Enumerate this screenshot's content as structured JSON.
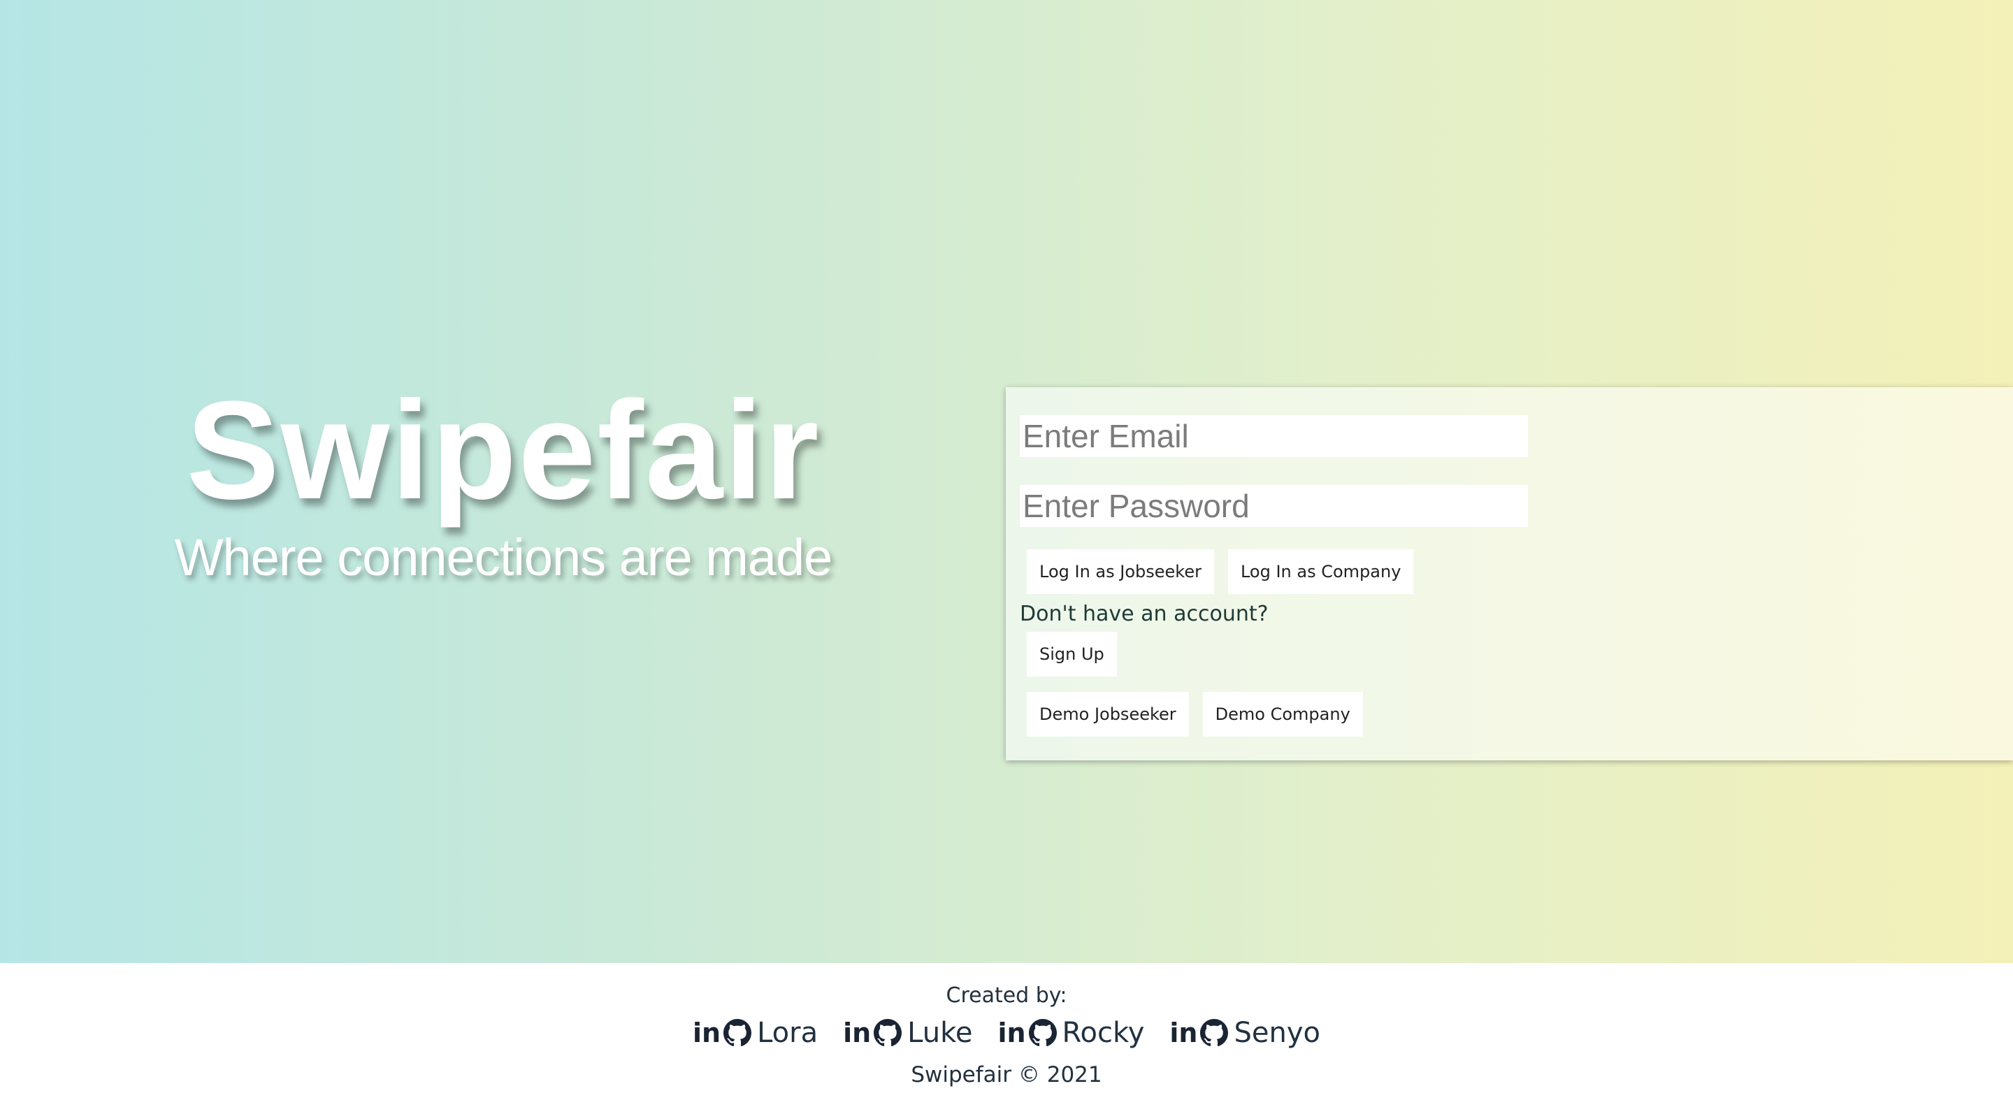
{
  "brand": {
    "title": "Swipefair",
    "tagline": "Where connections are made"
  },
  "login": {
    "email_placeholder": "Enter Email",
    "password_placeholder": "Enter Password",
    "login_jobseeker_label": "Log In as Jobseeker",
    "login_company_label": "Log In as Company",
    "no_account_text": "Don't have an account?",
    "signup_label": "Sign Up",
    "demo_jobseeker_label": "Demo Jobseeker",
    "demo_company_label": "Demo Company"
  },
  "footer": {
    "created_by": "Created by:",
    "authors": [
      {
        "name": "Lora",
        "icons": [
          "linkedin-icon",
          "github-icon"
        ]
      },
      {
        "name": "Luke",
        "icons": [
          "linkedin-icon",
          "github-icon"
        ]
      },
      {
        "name": "Rocky",
        "icons": [
          "linkedin-icon",
          "github-icon"
        ]
      },
      {
        "name": "Senyo",
        "icons": [
          "linkedin-icon",
          "github-icon"
        ]
      }
    ],
    "linkedin_glyph": "in",
    "copyright": "Swipefair © 2021"
  },
  "colors": {
    "gradient_start": "#b5e6e5",
    "gradient_end": "#f4f1b8",
    "footer_text": "#22313f"
  }
}
